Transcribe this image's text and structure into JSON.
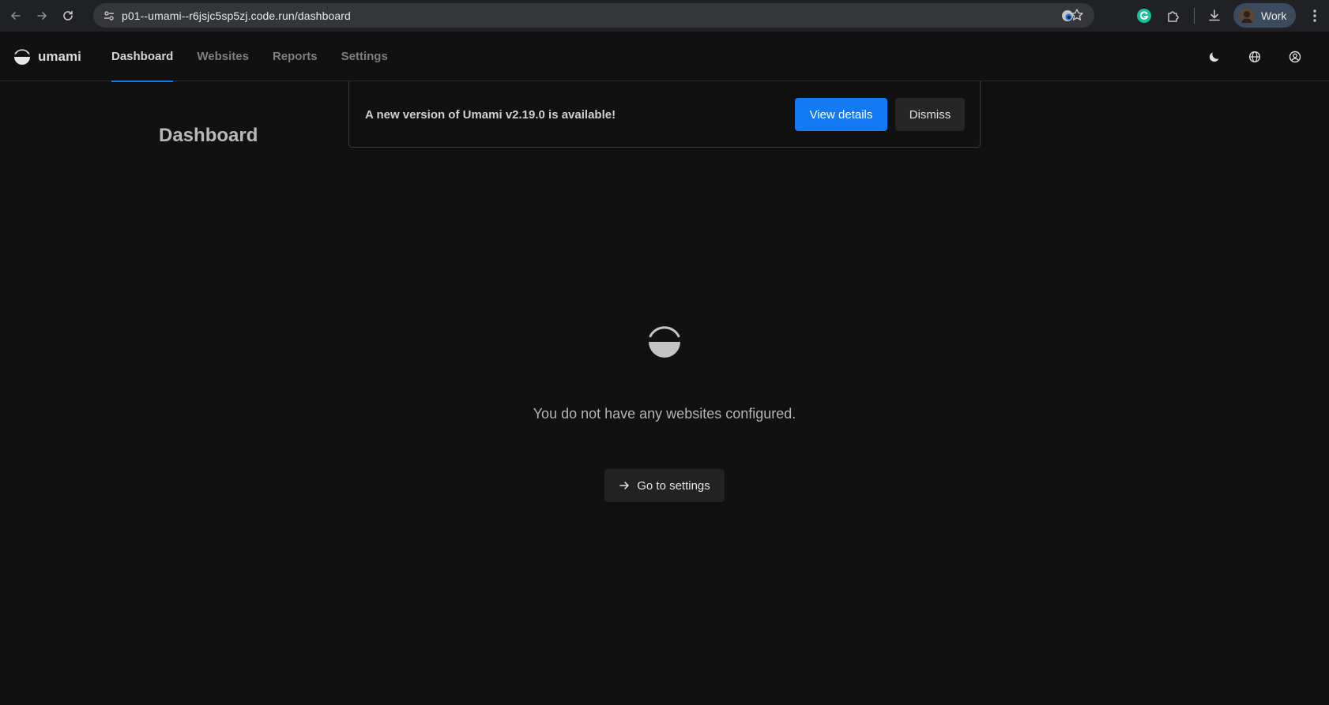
{
  "browser": {
    "url": "p01--umami--r6jsjc5sp5zj.code.run/dashboard",
    "profile_label": "Work",
    "icons": [
      "back-icon",
      "forward-icon",
      "reload-icon",
      "site-settings-icon",
      "bookmark-star-icon",
      "extension-icon",
      "grammarly-icon",
      "puzzle-icon",
      "download-icon",
      "menu-kebab-icon"
    ]
  },
  "app": {
    "name": "umami",
    "nav": [
      {
        "label": "Dashboard",
        "active": true
      },
      {
        "label": "Websites",
        "active": false
      },
      {
        "label": "Reports",
        "active": false
      },
      {
        "label": "Settings",
        "active": false
      }
    ],
    "header_icons": [
      "theme-moon-icon",
      "language-globe-icon",
      "profile-user-icon"
    ]
  },
  "page": {
    "title": "Dashboard"
  },
  "banner": {
    "message": "A new version of Umami v2.19.0 is available!",
    "view_details_label": "View details",
    "dismiss_label": "Dismiss"
  },
  "empty_state": {
    "message": "You do not have any websites configured.",
    "button_label": "Go to settings"
  },
  "colors": {
    "accent": "#147af3",
    "background": "#111111",
    "chrome": "#202124"
  }
}
